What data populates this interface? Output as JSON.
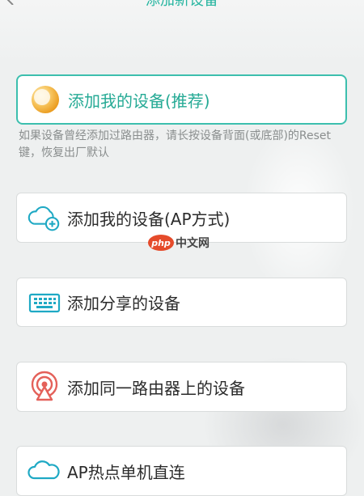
{
  "header": {
    "title": "添加新设备"
  },
  "primary_option": {
    "label": "添加我的设备(推荐)",
    "icon": "orange-circle-icon"
  },
  "hint": {
    "text": "如果设备曾经添加过路由器，请长按设备背面(或底部)的Reset键，恢复出厂默认"
  },
  "options": [
    {
      "label": "添加我的设备(AP方式)",
      "icon": "cloud-plus-icon"
    },
    {
      "label": "添加分享的设备",
      "icon": "keyboard-icon"
    },
    {
      "label": "添加同一路由器上的设备",
      "icon": "router-signal-icon"
    },
    {
      "label": "AP热点单机直连",
      "icon": "cloud-icon"
    }
  ],
  "watermark": {
    "logo": "php",
    "text": "中文网"
  },
  "colors": {
    "accent": "#25aa95",
    "accent_border": "#3cbfae",
    "icon_teal": "#1fa9c4",
    "router_red": "#e4615a",
    "orange": "#f3a52b"
  }
}
